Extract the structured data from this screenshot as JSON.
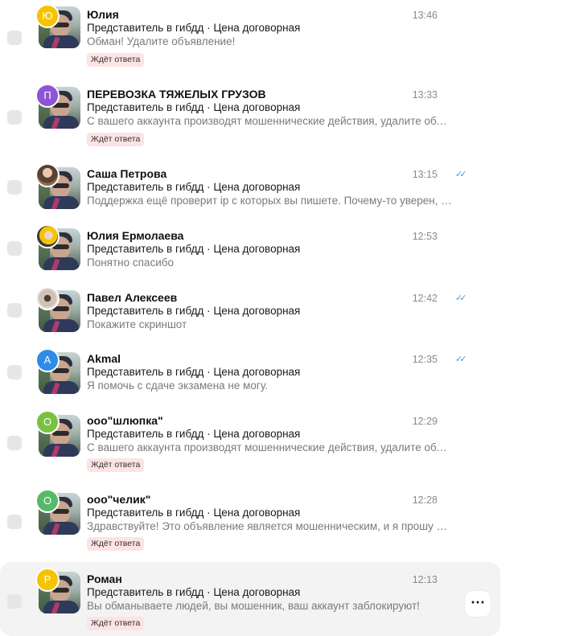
{
  "colors": {
    "badge_bg": "#fde3e3",
    "read_ticks": "#3f9be0",
    "avatar_yellow": "#f5c400",
    "avatar_purple": "#8e54d6",
    "avatar_blue": "#2f8be8",
    "avatar_green": "#7ac143",
    "avatar_green2": "#58b86a"
  },
  "badge_label": "Ждёт ответа",
  "conversations": [
    {
      "name": "Юлия",
      "avatar_letter": "Ю",
      "subject": "Представитель в гибдд · Цена договорная",
      "message": "Обман! Удалите объявление!",
      "time": "13:46",
      "badge": "Ждёт ответа"
    },
    {
      "name": "ПЕРЕВОЗКА ТЯЖЕЛЫХ ГРУЗОВ",
      "avatar_letter": "П",
      "subject": "Представитель в гибдд · Цена договорная",
      "message": "С вашего аккаунта производят мошеннические действия, удалите объявле...",
      "time": "13:33",
      "badge": "Ждёт ответа"
    },
    {
      "name": "Саша Петрова",
      "avatar_icon": "user-photo",
      "subject": "Представитель в гибдд · Цена договорная",
      "message": "Поддержка ещё проверит ip с которых вы пишете. Почему-то уверен, что...",
      "time": "13:15",
      "read_ticks": "✓✓"
    },
    {
      "name": "Юлия Ермолаева",
      "avatar_icon": "user-photo",
      "subject": "Представитель в гибдд · Цена договорная",
      "message": "Понятно спасибо",
      "time": "12:53"
    },
    {
      "name": "Павел Алексеев",
      "avatar_icon": "user-photo",
      "subject": "Представитель в гибдд · Цена договорная",
      "message": "Покажите скриншот",
      "time": "12:42",
      "read_ticks": "✓✓"
    },
    {
      "name": "Akmal",
      "avatar_letter": "A",
      "subject": "Представитель в гибдд · Цена договорная",
      "message": "Я помочь с сдаче экзамена не могу.",
      "time": "12:35",
      "read_ticks": "✓✓"
    },
    {
      "name": "ооо\"шлюпка\"",
      "avatar_letter": "О",
      "subject": "Представитель в гибдд · Цена договорная",
      "message": "С вашего аккаунта производят мошеннические действия, удалите объявле...",
      "time": "12:29",
      "badge": "Ждёт ответа"
    },
    {
      "name": "ооо\"челик\"",
      "avatar_letter": "О",
      "subject": "Представитель в гибдд · Цена договорная",
      "message": "Здравствуйте! Это объявление является мошенническим, и я прошу вас не...",
      "time": "12:28",
      "badge": "Ждёт ответа"
    },
    {
      "name": "Роман",
      "avatar_letter": "Р",
      "subject": "Представитель в гибдд · Цена договорная",
      "message": "Вы обманываете людей, вы мошенник, ваш аккаунт заблокируют!",
      "time": "12:13",
      "badge": "Ждёт ответа",
      "more_icon": "⋯"
    }
  ]
}
